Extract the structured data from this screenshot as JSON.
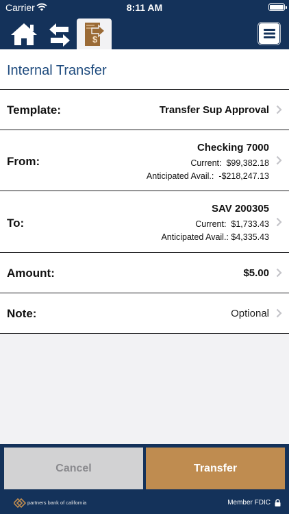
{
  "status": {
    "carrier": "Carrier",
    "time": "8:11 AM"
  },
  "nav": {
    "icons": [
      "home-icon",
      "transfer-arrows-icon",
      "transfer-document-icon",
      "menu-icon"
    ],
    "active_tab": "transfer"
  },
  "page": {
    "title": "Internal Transfer"
  },
  "form": {
    "template": {
      "label": "Template:",
      "value": "Transfer Sup Approval"
    },
    "from": {
      "label": "From:",
      "account": "Checking 7000",
      "current_label": "Current:",
      "current": "$99,382.18",
      "anticipated_label": "Anticipated Avail.:",
      "anticipated": "-$218,247.13"
    },
    "to": {
      "label": "To:",
      "account": "SAV 200305",
      "current_label": "Current:",
      "current": "$1,733.43",
      "anticipated_label": "Anticipated Avail.:",
      "anticipated": "$4,335.43"
    },
    "amount": {
      "label": "Amount:",
      "value": "$5.00"
    },
    "note": {
      "label": "Note:",
      "placeholder": "Optional"
    }
  },
  "actions": {
    "cancel": "Cancel",
    "transfer": "Transfer"
  },
  "footer": {
    "brand": "partners bank of california",
    "fdic": "Member FDIC"
  },
  "colors": {
    "navy": "#14325a",
    "accent": "#bf8c50",
    "title_blue": "#1d4a7d",
    "cancel_gray": "#d2d2d3"
  }
}
